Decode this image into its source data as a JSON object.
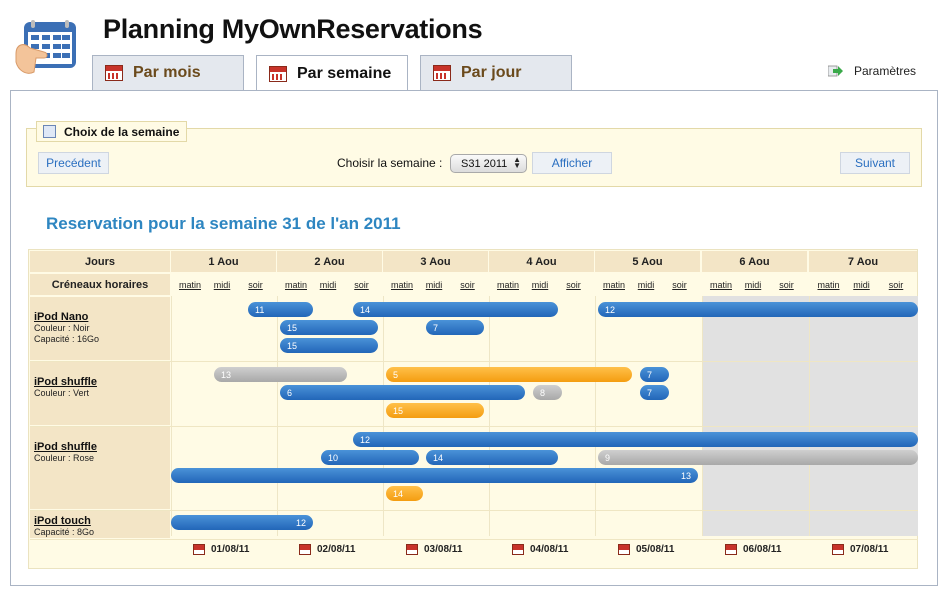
{
  "app": {
    "title": "Planning MyOwnReservations"
  },
  "tabs": [
    {
      "label": "Par mois",
      "icon": "calendar-icon"
    },
    {
      "label": "Par semaine",
      "icon": "calendar-icon"
    },
    {
      "label": "Par jour",
      "icon": "calendar-icon"
    }
  ],
  "params": {
    "label": "Paramètres",
    "icon": "arrow-right-icon"
  },
  "week_chooser": {
    "legend": "Choix de la semaine",
    "prev": "Precédent",
    "choose_label": "Choisir la semaine :",
    "selected": "S31 2011",
    "show": "Afficher",
    "next": "Suivant"
  },
  "heading": "Reservation pour la semaine 31 de l'an 2011",
  "grid": {
    "col_days_label": "Jours",
    "col_slots_label": "Créneaux horaires",
    "days": [
      "1 Aou",
      "2 Aou",
      "3 Aou",
      "4 Aou",
      "5 Aou",
      "6 Aou",
      "7 Aou"
    ],
    "slots": [
      "matin",
      "midi",
      "soir"
    ],
    "resources": [
      {
        "name": "iPod Nano",
        "lines": [
          "Couleur : Noir",
          "Capacité : 16Go"
        ]
      },
      {
        "name": "iPod shuffle",
        "lines": [
          "Couleur : Vert"
        ]
      },
      {
        "name": "iPod shuffle",
        "lines": [
          "Couleur : Rose"
        ]
      },
      {
        "name": "iPod touch",
        "lines": [
          "Capacité : 8Go"
        ]
      }
    ],
    "footer_dates": [
      "01/08/11",
      "02/08/11",
      "03/08/11",
      "04/08/11",
      "05/08/11",
      "06/08/11",
      "07/08/11"
    ],
    "reservations": [
      {
        "label": "11",
        "color": "blue"
      },
      {
        "label": "14",
        "color": "blue"
      },
      {
        "label": "12",
        "color": "blue"
      },
      {
        "label": "15",
        "color": "blue"
      },
      {
        "label": "7",
        "color": "blue"
      },
      {
        "label": "15",
        "color": "blue"
      },
      {
        "label": "13",
        "color": "gray"
      },
      {
        "label": "5",
        "color": "orange"
      },
      {
        "label": "7",
        "color": "blue"
      },
      {
        "label": "6",
        "color": "blue"
      },
      {
        "label": "8",
        "color": "gray"
      },
      {
        "label": "7",
        "color": "blue"
      },
      {
        "label": "15",
        "color": "orange"
      },
      {
        "label": "12",
        "color": "blue"
      },
      {
        "label": "10",
        "color": "blue"
      },
      {
        "label": "14",
        "color": "blue"
      },
      {
        "label": "9",
        "color": "gray"
      },
      {
        "label": "13",
        "color": "blue"
      },
      {
        "label": "14",
        "color": "orange"
      },
      {
        "label": "12",
        "color": "blue"
      }
    ]
  },
  "colors": {
    "blue": "#2d77c8",
    "gray": "#b5b5b5",
    "orange": "#f7a823",
    "grid_bg": "#fffbe5",
    "header_bg": "#f3e5c6",
    "heading": "#2e86c1"
  }
}
